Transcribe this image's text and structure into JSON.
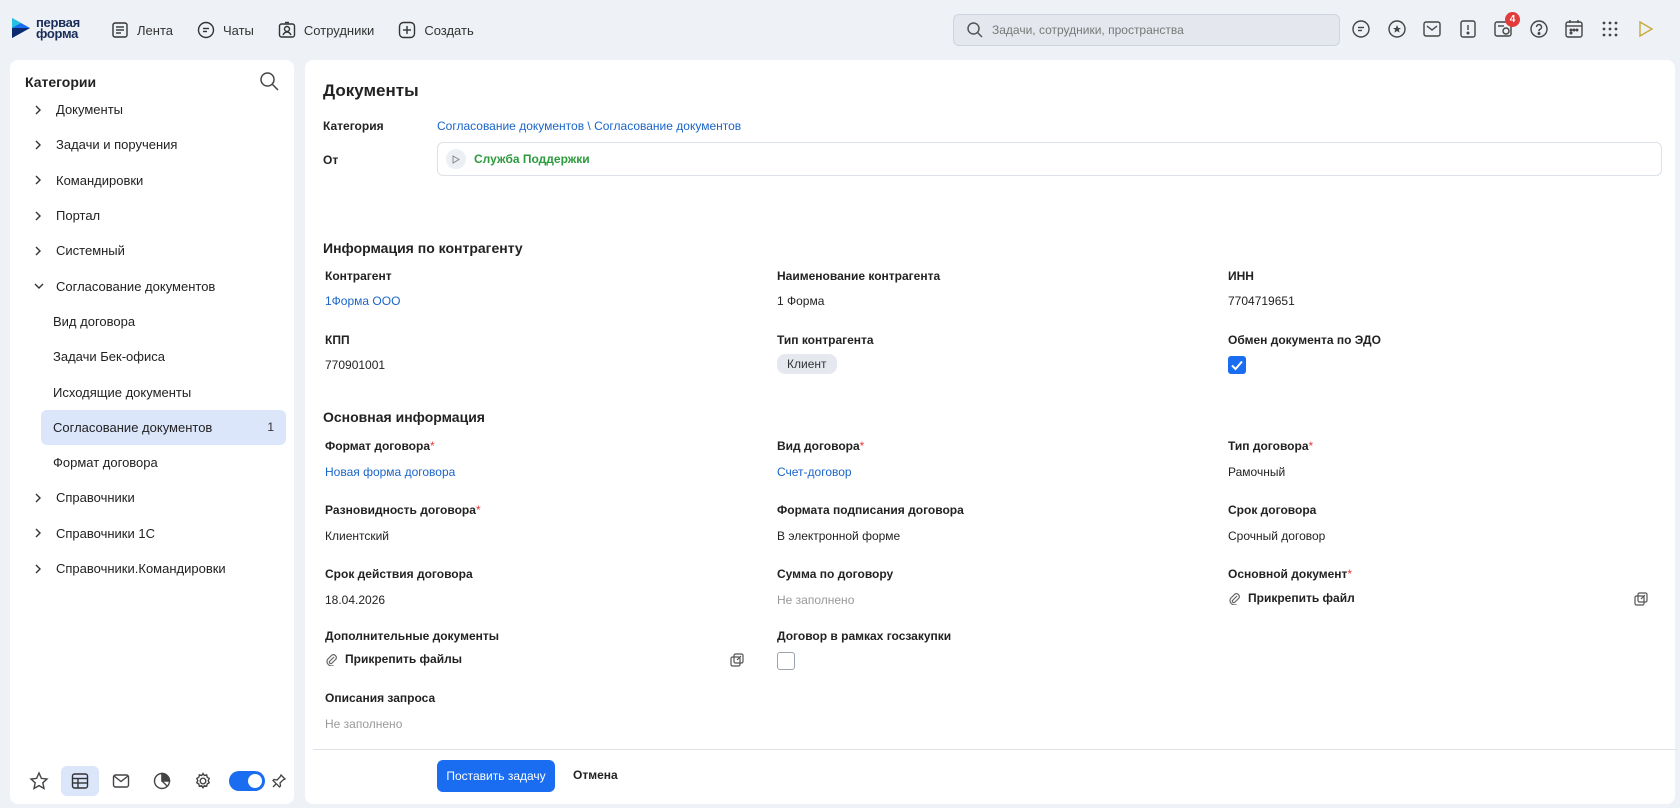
{
  "topbar": {
    "logo_line1": "первая",
    "logo_line2": "форма",
    "nav": [
      {
        "label": "Лента",
        "icon": "feed-icon"
      },
      {
        "label": "Чаты",
        "icon": "chat-icon"
      },
      {
        "label": "Сотрудники",
        "icon": "employees-icon"
      },
      {
        "label": "Создать",
        "icon": "plus-icon"
      }
    ],
    "search_placeholder": "Задачи, сотрудники, пространства",
    "notifications_badge": "4"
  },
  "sidebar": {
    "title": "Категории",
    "items": [
      {
        "label": "Документы"
      },
      {
        "label": "Задачи и поручения"
      },
      {
        "label": "Командировки"
      },
      {
        "label": "Портал"
      },
      {
        "label": "Системный"
      },
      {
        "label": "Согласование документов"
      },
      {
        "label": "Вид договора"
      },
      {
        "label": "Задачи Бек-офиса"
      },
      {
        "label": "Исходящие документы"
      },
      {
        "label": "Согласование документов",
        "count": "1"
      },
      {
        "label": "Формат договора"
      },
      {
        "label": "Справочники"
      },
      {
        "label": "Справочники 1С"
      },
      {
        "label": "Справочники.Командировки"
      }
    ]
  },
  "main": {
    "title": "Документы",
    "category_label": "Категория",
    "category_value": "Согласование документов \\ Согласование документов",
    "from_label": "От",
    "from_value": "Служба Поддержки",
    "section1": "Информация по контрагенту",
    "section2": "Основная информация",
    "fields": {
      "kontragent_label": "Контрагент",
      "kontragent_value": "1Форма ООО",
      "naim_label": "Наименование контрагента",
      "naim_value": "1 Форма",
      "inn_label": "ИНН",
      "inn_value": "7704719651",
      "kpp_label": "КПП",
      "kpp_value": "770901001",
      "tip_k_label": "Тип контрагента",
      "tip_k_value": "Клиент",
      "edo_label": "Обмен документа по ЭДО",
      "format_label": "Формат договора",
      "format_value": "Новая форма договора",
      "vid_label": "Вид договора",
      "vid_value": "Счет-договор",
      "tip_d_label": "Тип договора",
      "tip_d_value": "Рамочный",
      "razn_label": "Разновидность договора",
      "razn_value": "Клиентский",
      "podp_label": "Формата подписания договора",
      "podp_value": "В электронной форме",
      "srok_label": "Срок договора",
      "srok_value": "Срочный договор",
      "srok_d_label": "Срок действия договора",
      "srok_d_value": "18.04.2026",
      "summa_label": "Сумма по договору",
      "summa_value": "Не заполнено",
      "osn_doc_label": "Основной документ",
      "attach_file": "Прикрепить файл",
      "dop_doc_label": "Дополнительные документы",
      "attach_files": "Прикрепить файлы",
      "goszak_label": "Договор в рамках госзакупки",
      "opis_label": "Описания запроса",
      "opis_value": "Не заполнено",
      "required_mark": "*"
    },
    "submit_label": "Поставить задачу",
    "cancel_label": "Отмена"
  }
}
